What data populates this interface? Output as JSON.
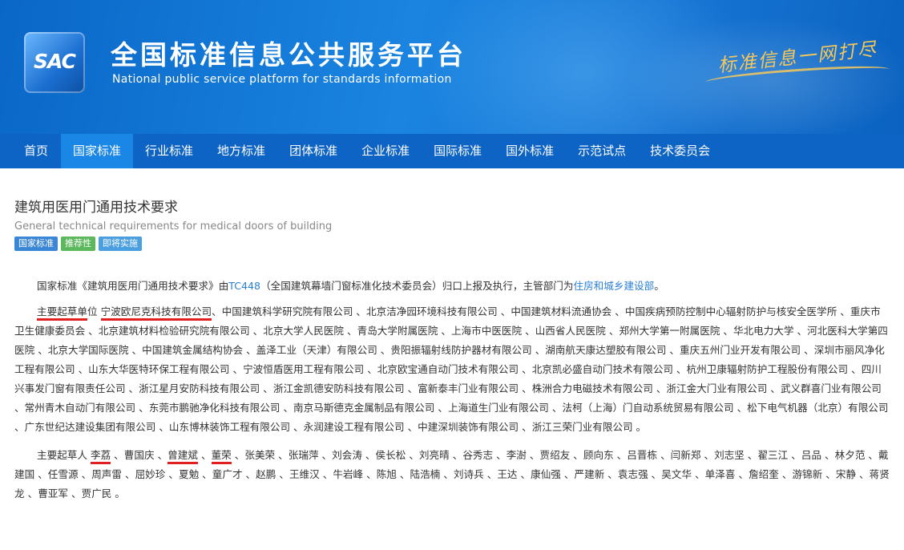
{
  "header": {
    "logo_text": "SAC",
    "title": "全国标准信息公共服务平台",
    "subtitle": "National public service platform  for standards information",
    "slogan": "标准信息一网打尽"
  },
  "nav": {
    "items": [
      {
        "label": "首页"
      },
      {
        "label": "国家标准"
      },
      {
        "label": "行业标准"
      },
      {
        "label": "地方标准"
      },
      {
        "label": "团体标准"
      },
      {
        "label": "企业标准"
      },
      {
        "label": "国际标准"
      },
      {
        "label": "国外标准"
      },
      {
        "label": "示范试点"
      },
      {
        "label": "技术委员会"
      }
    ],
    "active_index": 1
  },
  "standard": {
    "title": "建筑用医用门通用技术要求",
    "title_en": "General technical requirements for medical doors of building",
    "tags": [
      "国家标准",
      "推荐性",
      "即将实施"
    ]
  },
  "intro": {
    "prefix": "国家标准《建筑用医用门通用技术要求》由",
    "committee_code": "TC448",
    "committee_name": "（全国建筑幕墙门窗标准化技术委员会）归口上报及执行，主管部门为",
    "authority": "住房和城乡建设部",
    "suffix": "。"
  },
  "drafting_units": {
    "label_start": "主要起草单",
    "label_end": "位",
    "first_unit": "宁波欧尼克科技有限公司",
    "rest": "、中国建筑科学研究院有限公司 、北京洁净园环境科技有限公司 、中国建筑材料流通协会 、中国疾病预防控制中心辐射防护与核安全医学所 、重庆市卫生健康委员会 、北京建筑材料检验研究院有限公司 、北京大学人民医院 、青岛大学附属医院 、上海市中医医院 、山西省人民医院 、郑州大学第一附属医院 、华北电力大学 、河北医科大学第四医院 、北京大学国际医院 、中国建筑金属结构协会 、盖泽工业（天津）有限公司 、贵阳振辐射线防护器材有限公司 、湖南航天康达塑胶有限公司 、重庆五州门业开发有限公司 、深圳市丽风净化工程有限公司 、山东大华医特环保工程有限公司 、宁波恒盾医用工程有限公司 、北京欧宝通自动门技术有限公司 、北京凯必盛自动门技术有限公司 、杭州卫康辐射防护工程股份有限公司 、四川兴事发门窗有限责任公司 、浙江星月安防科技有限公司 、浙江金凯德安防科技有限公司 、富新泰丰门业有限公司 、株洲合力电磁技术有限公司 、浙江金大门业有限公司 、武义群喜门业有限公司 、常州青木自动门有限公司 、东莞市鹏驰净化科技有限公司 、南京马斯德克金属制品有限公司 、上海道生门业有限公司 、法柯（上海）门自动系统贸易有限公司 、松下电气机器（北京）有限公司 、广东世纪达建设集团有限公司 、山东博林装饰工程有限公司 、永润建设工程有限公司 、中建深圳装饰有限公司 、浙江三荣门业有限公司 。"
  },
  "drafters": {
    "label": "主要起草人 ",
    "names": [
      "李荔",
      "曹国庆",
      "曾建斌",
      "董荣",
      "张美荣",
      "张瑞萍",
      "刘会涛",
      "侯长松",
      "刘亮晴",
      "谷秀志",
      "李澍",
      "贾绍友",
      "顾向东",
      "吕晋栋",
      "闫新郑",
      "刘志坚",
      "翟三江",
      "吕品",
      "林夕范",
      "戴建国",
      "任雪源",
      "周声雷",
      "屈妙珍",
      "夏勉",
      "童广才",
      "赵鹏",
      "王维汉",
      "牛岩峰",
      "陈旭",
      "陆浩楠",
      "刘诗兵",
      "王达",
      "康仙强",
      "严建新",
      "袁志强",
      "吴文华",
      "单泽喜",
      "詹绍奎",
      "游锦新",
      "宋静",
      "蒋贤龙",
      "曹亚军",
      "贾广民"
    ],
    "underlined": [
      "李荔",
      "曾建斌",
      "董荣"
    ],
    "separator": " 、",
    "end": " 。"
  },
  "colors": {
    "nav_bg": "#0e64c4",
    "nav_active": "#1a86e6",
    "link": "#2a7fd4",
    "underline_red": "#e02020"
  }
}
